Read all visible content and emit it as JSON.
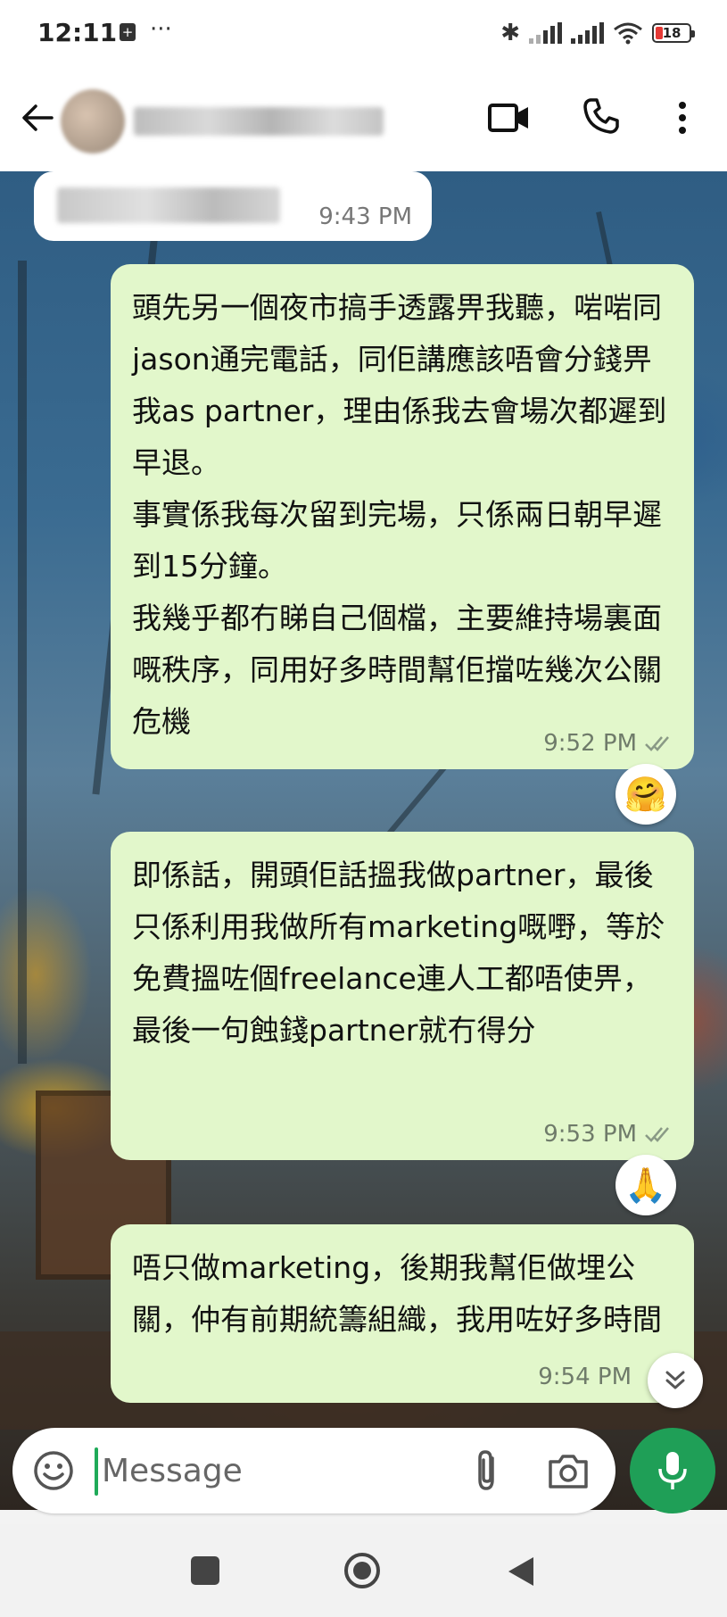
{
  "status_bar": {
    "time": "12:11",
    "more_indicator": "···",
    "battery_level": "18",
    "battery_color": "#e53935"
  },
  "header": {
    "contact_name": "████ ████ ████"
  },
  "messages": [
    {
      "direction": "incoming",
      "text": "██████",
      "time": "9:43 PM"
    },
    {
      "direction": "outgoing",
      "text": "頭先另一個夜市搞手透露畀我聽，啱啱同jason通完電話，同佢講應該唔會分錢畀我as partner，理由係我去會場次都遲到早退。\n事實係我每次留到完場，只係兩日朝早遲到15分鐘。\n我幾乎都冇睇自己個檔，主要維持場裏面嘅秩序，同用好多時間幫佢擋咗幾次公關危機",
      "time": "9:52 PM",
      "reaction": "🤗"
    },
    {
      "direction": "outgoing",
      "text": "即係話，開頭佢話搵我做partner，最後只係利用我做所有marketing嘅嘢，等於免費搵咗個freelance連人工都唔使畀，最後一句蝕錢partner就冇得分",
      "time": "9:53 PM",
      "reaction": "🙏"
    },
    {
      "direction": "outgoing",
      "text": "唔只做marketing，後期我幫佢做埋公關，仲有前期統籌組織，我用咗好多時間",
      "time": "9:54 PM"
    }
  ],
  "composer": {
    "placeholder": "Message"
  },
  "colors": {
    "outgoing_bubble": "#e2f7cb",
    "incoming_bubble": "#ffffff",
    "mic_button": "#1f9f57",
    "read_ticks": "#8a9a86"
  },
  "icons": {
    "back": "arrow-left",
    "video": "video-camera",
    "phone": "phone-handset",
    "menu": "vertical-dots",
    "emoji": "smiley",
    "attach": "paperclip",
    "camera": "camera",
    "mic": "microphone",
    "scroll": "double-chevron-down"
  }
}
